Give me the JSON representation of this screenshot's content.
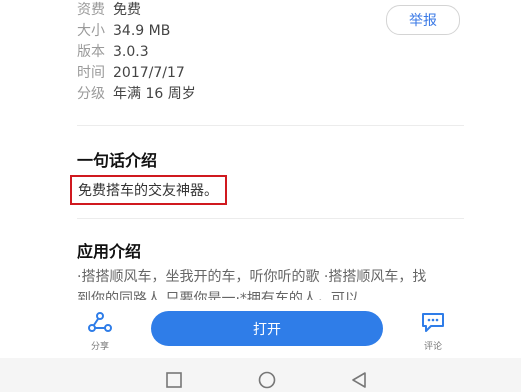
{
  "info": {
    "rows": [
      {
        "key": "资费",
        "value": "免费"
      },
      {
        "key": "大小",
        "value": "34.9 MB"
      },
      {
        "key": "版本",
        "value": "3.0.3"
      },
      {
        "key": "时间",
        "value": "2017/7/17"
      },
      {
        "key": "分级",
        "value": "年满 16 周岁"
      }
    ],
    "report_label": "举报"
  },
  "tagline": {
    "title": "一句话介绍",
    "text": "免费搭车的交友神器。"
  },
  "intro": {
    "title": "应用介绍",
    "line1": "·搭搭顺风车，坐我开的车，听你听的歌 ·搭搭顺风车，找",
    "line2": "到你的同路人 只要你是一·*拥有车的人，可以"
  },
  "actions": {
    "share_label": "分享",
    "open_label": "打开",
    "comment_label": "评论"
  },
  "colors": {
    "accent": "#2f7de8",
    "highlight_border": "#d0191f"
  },
  "icons": {
    "share": "share-icon",
    "comment": "comment-icon",
    "nav_square": "square-icon",
    "nav_home": "circle-icon",
    "nav_back": "triangle-icon"
  }
}
